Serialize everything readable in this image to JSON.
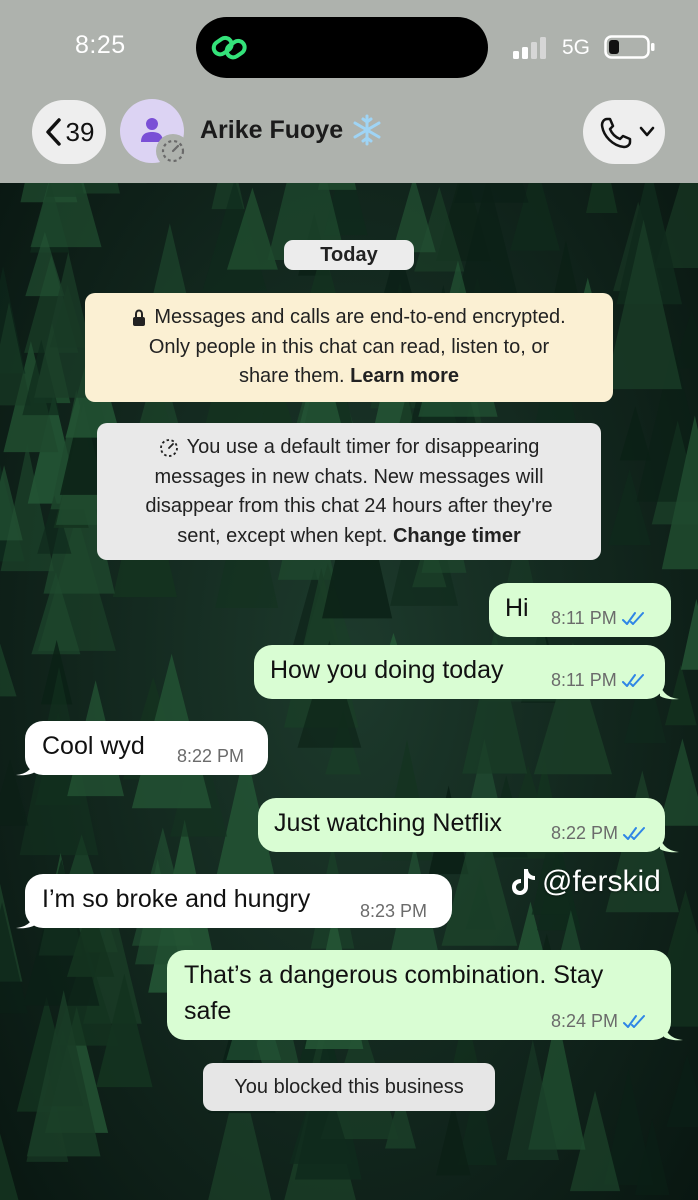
{
  "status_bar": {
    "time": "8:25",
    "network": "5G",
    "island_icon": "link-icon",
    "island_color": "#34e27a"
  },
  "header": {
    "back_count": "39",
    "contact_name": "Arike Fuoye",
    "name_emoji": "snowflake-icon",
    "header_color": "#aeb2ad"
  },
  "chat": {
    "date_label": "Today",
    "encryption_notice": "Messages and calls are end-to-end encrypted. Only people in this chat can read, listen to, or share them.",
    "encryption_link": "Learn more",
    "timer_notice": "You use a default timer for disappearing messages in new chats. New messages will disappear from this chat 24 hours after they're sent, except when kept.",
    "timer_link": "Change timer",
    "messages": [
      {
        "direction": "out",
        "text": "Hi",
        "time": "8:11 PM",
        "status": "read"
      },
      {
        "direction": "out",
        "text": "How you doing today",
        "time": "8:11 PM",
        "status": "read"
      },
      {
        "direction": "in",
        "text": "Cool wyd",
        "time": "8:22 PM"
      },
      {
        "direction": "out",
        "text": "Just watching Netflix",
        "time": "8:22 PM",
        "status": "read"
      },
      {
        "direction": "in",
        "text": "I’m so broke and hungry",
        "time": "8:23 PM"
      },
      {
        "direction": "out",
        "text": "That’s a dangerous combination. Stay safe",
        "line1": "That’s a dangerous combination. Stay",
        "line2": "safe",
        "time": "8:24 PM",
        "status": "read"
      }
    ],
    "blocked_notice": "You blocked this business"
  },
  "watermark": {
    "handle": "@ferskid",
    "icon": "tiktok-icon"
  },
  "colors": {
    "outgoing_bubble": "#d9fdd3",
    "incoming_bubble": "#ffffff",
    "read_ticks": "#2f86e6",
    "encryption_notice_bg": "#fbf0d3"
  }
}
